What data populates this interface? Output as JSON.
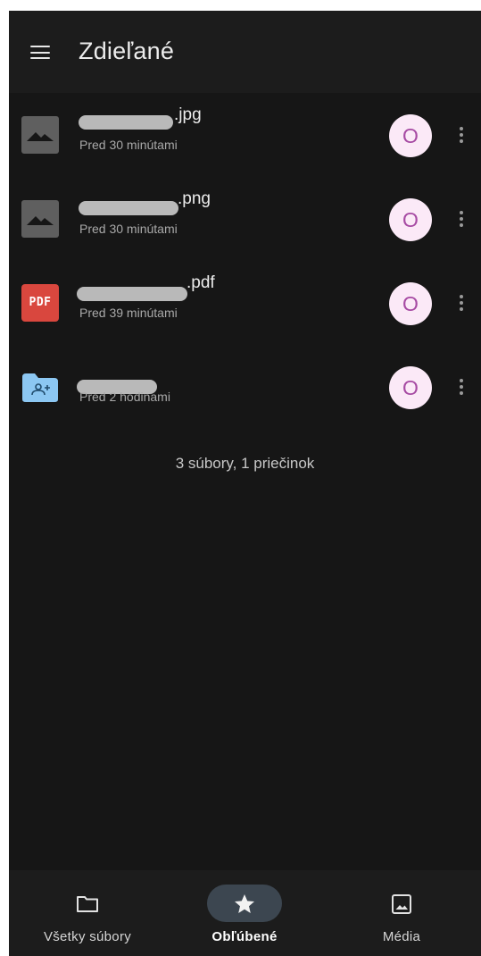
{
  "app": {
    "title": "Zdieľané"
  },
  "files": [
    {
      "name_suffix": ".jpg",
      "time": "Pred 30 minútami",
      "icon": "image-icon",
      "owner_initial": "O"
    },
    {
      "name_suffix": ".png",
      "time": "Pred 30 minútami",
      "icon": "image-icon",
      "owner_initial": "O"
    },
    {
      "name_suffix": ".pdf",
      "time": "Pred 39 minútami",
      "icon": "pdf-icon",
      "icon_text": "PDF",
      "owner_initial": "O"
    },
    {
      "name_suffix": "",
      "time": "Pred 2 hodinami",
      "icon": "shared-folder-icon",
      "owner_initial": "O"
    }
  ],
  "summary": "3 súbory, 1 priečinok",
  "nav": {
    "items": [
      {
        "label": "Všetky súbory",
        "icon": "folder-icon",
        "active": false
      },
      {
        "label": "Obľúbené",
        "icon": "star-icon",
        "active": true
      },
      {
        "label": "Média",
        "icon": "image-icon",
        "active": false
      }
    ]
  },
  "colors": {
    "background": "#161616",
    "appbar": "#1c1c1c",
    "avatar_bg": "#fbe9f7",
    "avatar_fg": "#a64aa3",
    "pdf_red": "#d9473e",
    "folder_blue": "#8cc7f2",
    "active_pill": "#3c4650"
  }
}
